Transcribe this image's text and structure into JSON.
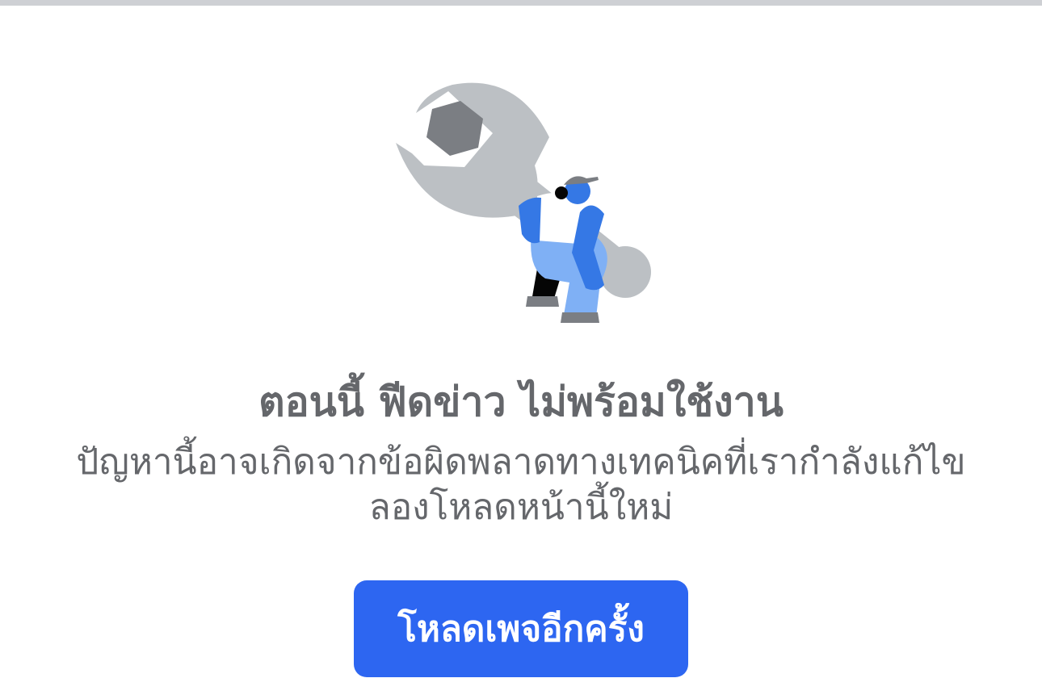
{
  "error": {
    "title": "ตอนนี้ ฟีดข่าว ไม่พร้อมใช้งาน",
    "message": "ปัญหานี้อาจเกิดจากข้อผิดพลาดทางเทคนิคที่เรากำลังแก้ไข ลองโหลดหน้านี้ใหม่",
    "illustration": "wrench-worker-illustration"
  },
  "reload_button": {
    "label": "โหลดเพจอีกครั้ง",
    "color": "#2d66f1"
  },
  "colors": {
    "text": "#65676b",
    "wrench": "#bcc0c4",
    "accent_blue": "#3578e5",
    "light_blue": "#7fb0f5"
  }
}
